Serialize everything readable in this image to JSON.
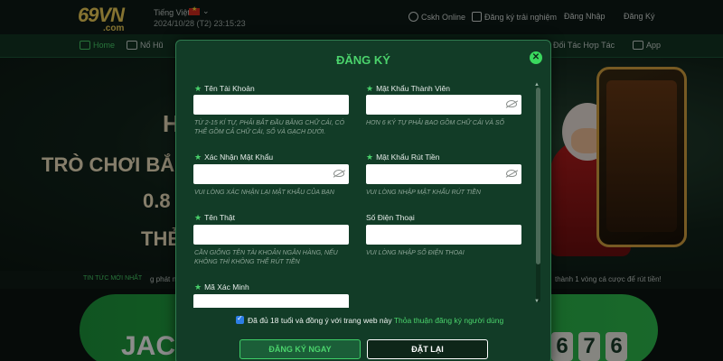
{
  "header": {
    "logo_main": "69VN",
    "logo_sub": ".com",
    "language": "Tiếng Việt",
    "datetime": "2024/10/28 (T2) 23:15:23",
    "support": "Cskh Online",
    "trial": "Đăng ký trải nghiệm",
    "login": "Đăng Nhập",
    "register": "Đăng Ký"
  },
  "nav": {
    "items": [
      {
        "label": "Home"
      },
      {
        "label": "Nổ Hũ"
      },
      {
        "label": "Đối Tác Hợp Tác"
      },
      {
        "label": "App"
      }
    ]
  },
  "hero": {
    "line1": "H",
    "line2": "TRÒ CHƠI BẮN",
    "line3": "0.8",
    "line4": "THẺ"
  },
  "ticker": {
    "label": "TIN TỨC MỚI NHẤT",
    "left": "g phát n",
    "right": "thành 1 vòng cá cược để rút tiền!"
  },
  "jackpot": {
    "label": "JAC",
    "digits": [
      "6",
      "7",
      "6"
    ]
  },
  "modal": {
    "title": "ĐĂNG KÝ",
    "close": "✕",
    "fields": {
      "username": {
        "label": "Tên Tài Khoản",
        "hint": "Từ 2-15 kí tự, phải bắt đầu bằng chữ cái, có thể gồm cả chữ cái, số và gạch dưới."
      },
      "password": {
        "label": "Mật Khẩu Thành Viên",
        "hint": "Hơn 6 ký tự phải bao gồm chữ cái và số"
      },
      "confirm_password": {
        "label": "Xác Nhận Mật Khẩu",
        "hint": "Vui lòng xác nhận lại mật khẩu của bạn"
      },
      "withdraw_password": {
        "label": "Mật Khẩu Rút Tiền",
        "hint": "Vui lòng nhập mật khẩu rút tiền"
      },
      "real_name": {
        "label": "Tên Thật",
        "hint": "Cần giống tên tài khoản ngân hàng, nếu không thì không thể rút tiền"
      },
      "phone": {
        "label": "Số Điện Thoại",
        "hint": "Vui lòng nhập số điện thoại"
      },
      "captcha": {
        "label": "Mã Xác Minh"
      }
    },
    "agree_text": "Đã đủ 18 tuổi và đồng ý với trang web này",
    "agree_link": "Thỏa thuận đăng ký người dùng",
    "register_button": "ĐĂNG KÝ NGAY",
    "reset_button": "ĐẶT LẠI"
  },
  "colors": {
    "accent": "#4bd36c",
    "modal_bg": "#123c27",
    "checkbox": "#2d7ee6"
  }
}
